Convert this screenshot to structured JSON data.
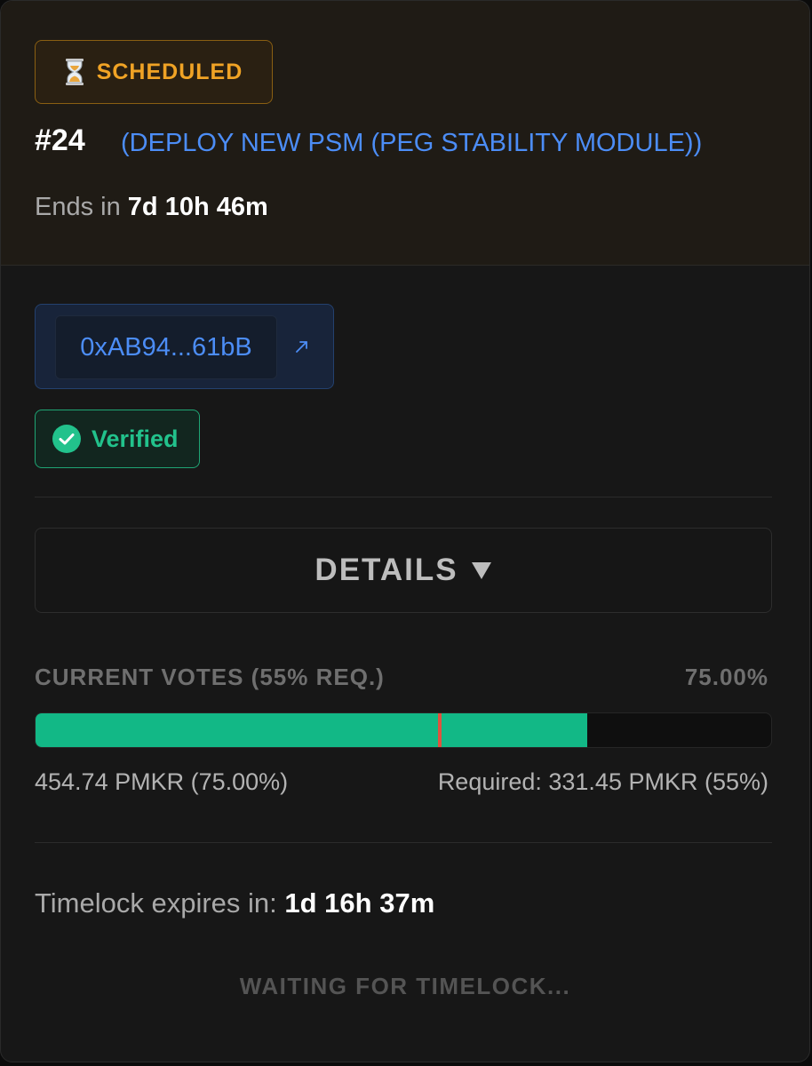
{
  "proposal": {
    "status_label": "SCHEDULED",
    "status_icon": "hourglass-icon",
    "number": "#24",
    "title": "(DEPLOY NEW PSM (PEG STABILITY MODULE))",
    "ends_prefix": "Ends in ",
    "ends_value": "7d 10h 46m",
    "colors": {
      "status_accent": "#f0a325",
      "link": "#4c8df6",
      "verified": "#22c28c",
      "vote_fill": "#12b886",
      "threshold": "#e0533f"
    }
  },
  "contract": {
    "address": "0xAB94...61bB",
    "link_icon": "external-link-icon",
    "verified_label": "Verified",
    "verified_icon": "check-circle-icon"
  },
  "details": {
    "label": "DETAILS",
    "icon": "caret-down-icon"
  },
  "votes": {
    "heading": "CURRENT VOTES (55% REQ.)",
    "percent_label": "75.00%",
    "progress_fraction": 0.75,
    "required_fraction": 0.55,
    "amount_label": "454.74 PMKR (75.00%)",
    "required_label": "Required: 331.45 PMKR (55%)"
  },
  "timelock": {
    "prefix": "Timelock expires in: ",
    "value": "1d 16h 37m",
    "waiting_label": "WAITING FOR TIMELOCK..."
  }
}
